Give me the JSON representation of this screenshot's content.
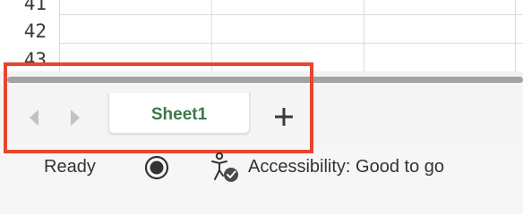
{
  "grid": {
    "row_numbers": [
      "41",
      "42",
      "43"
    ]
  },
  "sheet_tabs": {
    "tabs": [
      {
        "label": "Sheet1",
        "active": true
      }
    ],
    "active_color": "#3a7a4a",
    "nav_icons": [
      "chevron-left-icon",
      "chevron-right-icon"
    ],
    "add_icon": "plus-icon"
  },
  "status_bar": {
    "ready_label": "Ready",
    "accessibility_label": "Accessibility: Good to go",
    "icons": [
      "macro-record-icon",
      "accessibility-check-icon"
    ]
  },
  "annotation": {
    "highlight_color": "#e8442e"
  }
}
